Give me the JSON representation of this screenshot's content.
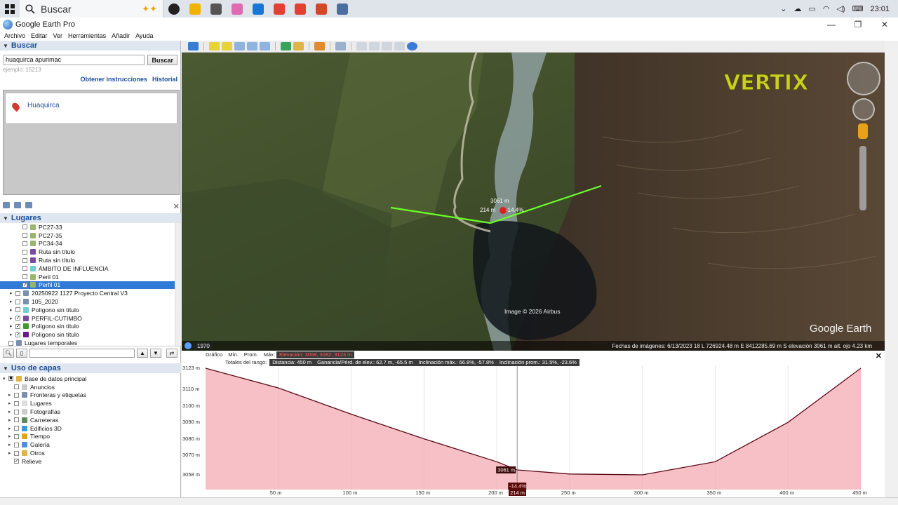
{
  "taskbar": {
    "search_placeholder": "Buscar",
    "clock": "23:01",
    "apps": [
      "#222",
      "#f0b400",
      "#555",
      "#e06ab0",
      "#1877d4",
      "#e34033",
      "#e34033",
      "#d24726",
      "#4a6ea0"
    ]
  },
  "window": {
    "title": "Google Earth Pro"
  },
  "menu": [
    "Archivo",
    "Editar",
    "Ver",
    "Herramientas",
    "Añadir",
    "Ayuda"
  ],
  "search": {
    "header": "Buscar",
    "query": "huaquirca apurimac",
    "button": "Buscar",
    "hint": "ejemplo: 15213",
    "link_directions": "Obtener instrucciones",
    "link_history": "Historial",
    "result": "Huaquirca"
  },
  "places": {
    "header": "Lugares",
    "items": [
      {
        "label": "PC27-33",
        "indent": 2,
        "checked": false,
        "icon": "path-icon",
        "selected": false
      },
      {
        "label": "PC27-35",
        "indent": 2,
        "checked": false,
        "icon": "path-icon",
        "selected": false
      },
      {
        "label": "PC34-34",
        "indent": 2,
        "checked": false,
        "icon": "path-icon",
        "selected": false
      },
      {
        "label": "Ruta sin título",
        "indent": 2,
        "checked": false,
        "icon": "route-icon",
        "selected": false
      },
      {
        "label": "Ruta sin título",
        "indent": 2,
        "checked": false,
        "icon": "route-icon",
        "selected": false
      },
      {
        "label": "ÁMBITO DE INFLUENCIA",
        "indent": 2,
        "checked": false,
        "icon": "polygon-icon",
        "selected": false
      },
      {
        "label": "Peril 01",
        "indent": 2,
        "checked": false,
        "icon": "path-icon",
        "selected": false
      },
      {
        "label": "Perfil 01",
        "indent": 2,
        "checked": true,
        "icon": "path-icon",
        "selected": true
      },
      {
        "label": "20250922 1127 Proyecto Central V3",
        "indent": 1,
        "checked": false,
        "icon": "folder-icon",
        "selected": false
      },
      {
        "label": "105_2020",
        "indent": 1,
        "checked": false,
        "icon": "folder-icon",
        "selected": false
      },
      {
        "label": "Polígono sin título",
        "indent": 1,
        "checked": false,
        "icon": "polygon-icon",
        "selected": false
      },
      {
        "label": "PERFIL-CUTIMBO",
        "indent": 1,
        "checked": true,
        "icon": "route-icon",
        "selected": false
      },
      {
        "label": "Polígono sin título",
        "indent": 1,
        "checked": true,
        "icon": "polygon-green-icon",
        "selected": false
      },
      {
        "label": "Polígono sin título",
        "indent": 1,
        "checked": true,
        "icon": "polygon-purple-icon",
        "selected": false
      },
      {
        "label": "Lugares temporales",
        "indent": 0,
        "checked": false,
        "icon": "folder-icon",
        "selected": false
      }
    ]
  },
  "layers": {
    "header": "Uso de capas",
    "root": "Base de datos principal",
    "items": [
      "Anuncios",
      "Fronteras y etiquetas",
      "Lugares",
      "Fotografías",
      "Carreteras",
      "Edificios 3D",
      "Tiempo",
      "Galería",
      "Otros",
      "Relieve"
    ]
  },
  "viewer": {
    "map_label_elev": "3061 m",
    "map_label_dist": "214 m",
    "map_label_slope": "-14.4%",
    "image_credit": "Image © 2026 Airbus",
    "watermark": "Google Earth",
    "logo_text": "VERTIX",
    "year": "1970",
    "status": "Fechas de imágenes: 6/13/2023     18 L 726924.48 m E 8412285.69 m S   elevación  3061 m      alt. ojo   4.23 km"
  },
  "profile": {
    "row1": {
      "grafico": "Gráfico",
      "min": "Mín.",
      "prom": "Prom.",
      "max": "Máx",
      "elev": "Elevación: 3058, 3082, 3123 m"
    },
    "row2": {
      "totales": "Totales del rango:",
      "distancia": "Distancia: 450 m",
      "ganancia": "Ganancia/Pérd. de elev.: 62.7 m, -65.5 m",
      "incl_max": "Inclinación máx.: 66.8%, -57.8%",
      "incl_prom": "Inclinación prom.: 31.5%, -23.6%"
    },
    "close": "✕",
    "cursor_elev": "3061 m",
    "cursor_slope": "-14.4%",
    "cursor_dist": "214 m",
    "y_ticks": [
      "3123 m",
      "3110 m",
      "3100 m",
      "3090 m",
      "3080 m",
      "3070 m",
      "3058 m"
    ],
    "x_ticks": [
      "50 m",
      "100 m",
      "150 m",
      "200 m",
      "250 m",
      "300 m",
      "350 m",
      "400 m",
      "450 m"
    ]
  },
  "chart_data": {
    "type": "area",
    "xlabel": "",
    "ylabel": "",
    "x": [
      0,
      50,
      100,
      150,
      200,
      214,
      250,
      300,
      350,
      400,
      450
    ],
    "values": [
      3123,
      3111,
      3095,
      3080,
      3066,
      3061,
      3058.5,
      3058,
      3066,
      3090,
      3123
    ],
    "ylim": [
      3058,
      3123
    ],
    "xlim": [
      0,
      450
    ]
  }
}
